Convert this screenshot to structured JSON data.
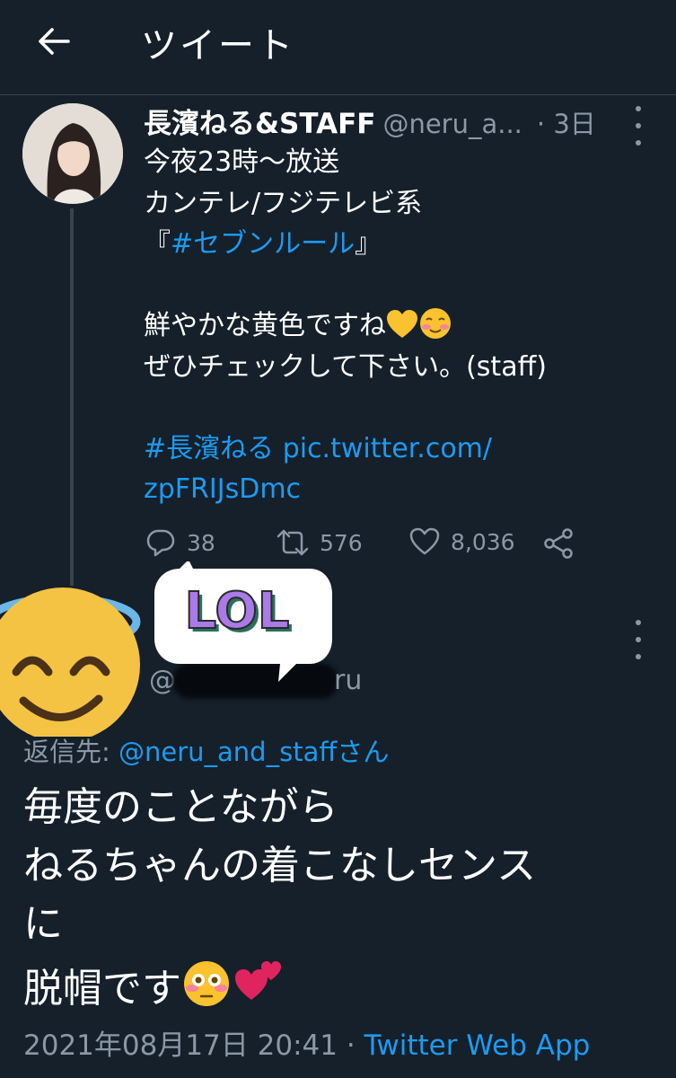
{
  "header": {
    "title": "ツイート",
    "back_icon": "arrow-left-icon"
  },
  "tweet": {
    "author_name": "長濱ねる&STAFF",
    "handle": "@neru_a...",
    "time": "· 3日",
    "lines": [
      "今夜23時～放送",
      "カンテレ/フジテレビ系"
    ],
    "bracket_open": "『",
    "hashtag_show": "#セブンルール",
    "bracket_close": "』",
    "line_yellow": "鮮やかな黄色ですね",
    "line_check": "ぜひチェックして下さい。(staff)",
    "hashtag_name": "#長濱ねる",
    "pic_link_1": "pic.twitter.com/",
    "pic_link_2": "zpFRIJsDmc",
    "reply_count": "38",
    "retweet_count": "576",
    "like_count": "8,036"
  },
  "reply": {
    "handle_start": "@",
    "handle_end": "ru",
    "reply_to_prefix": "返信先: ",
    "reply_to_handle": "@neru_and_staff",
    "reply_to_suffix": "さん",
    "text_lines": [
      "毎度のことながら",
      "ねるちゃんの着こなしセンス",
      "に",
      "脱帽です"
    ],
    "timestamp": "2021年08月17日 20:41",
    "separator": " · ",
    "source": "Twitter Web App"
  },
  "stickers": {
    "lol_text": "LOL"
  },
  "colors": {
    "background": "#15202b",
    "link": "#1d9bf0",
    "secondary_text": "#8b98a5",
    "divider": "#38444d"
  }
}
